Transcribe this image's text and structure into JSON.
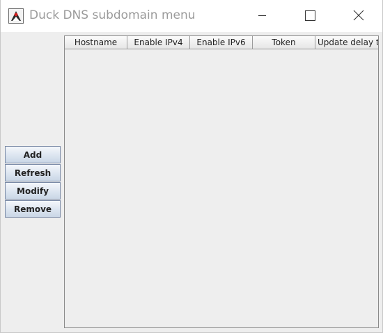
{
  "window": {
    "title": "Duck DNS subdomain menu"
  },
  "buttons": {
    "add": "Add",
    "refresh": "Refresh",
    "modify": "Modify",
    "remove": "Remove"
  },
  "table": {
    "columns": [
      "Hostname",
      "Enable IPv4",
      "Enable IPv6",
      "Token",
      "Update delay t..."
    ],
    "rows": []
  },
  "icons": {
    "app": "java-duke-icon",
    "minimize": "minimize-icon",
    "maximize": "maximize-icon",
    "close": "close-icon"
  }
}
